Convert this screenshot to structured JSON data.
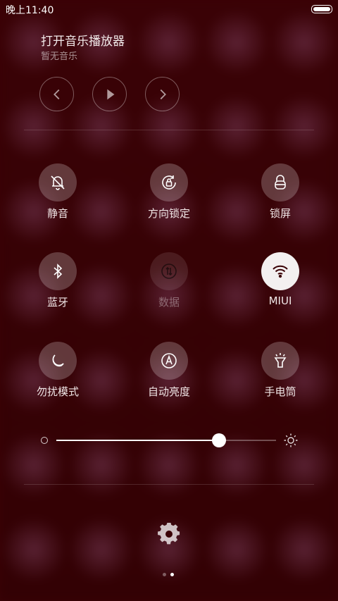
{
  "status_bar": {
    "time": "晚上11:40"
  },
  "music": {
    "title": "打开音乐播放器",
    "subtitle": "暂无音乐",
    "controls": [
      "previous-icon",
      "play-icon",
      "next-icon"
    ]
  },
  "toggles": [
    {
      "label": "静音",
      "icon": "bell-muted-icon",
      "state": "off"
    },
    {
      "label": "方向锁定",
      "icon": "rotation-lock-icon",
      "state": "off"
    },
    {
      "label": "锁屏",
      "icon": "lock-icon",
      "state": "off"
    },
    {
      "label": "蓝牙",
      "icon": "bluetooth-icon",
      "state": "off"
    },
    {
      "label": "数据",
      "icon": "mobile-data-icon",
      "state": "disabled"
    },
    {
      "label": "MIUI",
      "icon": "wifi-icon",
      "state": "on"
    },
    {
      "label": "勿扰模式",
      "icon": "moon-icon",
      "state": "off"
    },
    {
      "label": "自动亮度",
      "icon": "auto-brightness-icon",
      "state": "off"
    },
    {
      "label": "手电筒",
      "icon": "flashlight-icon",
      "state": "off"
    }
  ],
  "brightness": {
    "level": 0.74,
    "min_icon": "brightness-low-icon",
    "max_icon": "brightness-high-icon"
  },
  "footer": {
    "settings_icon": "gear-icon",
    "page_count": 2,
    "current_page": 2
  },
  "colors": {
    "background": "#3a0206",
    "active_toggle": "#f3f0f0"
  }
}
